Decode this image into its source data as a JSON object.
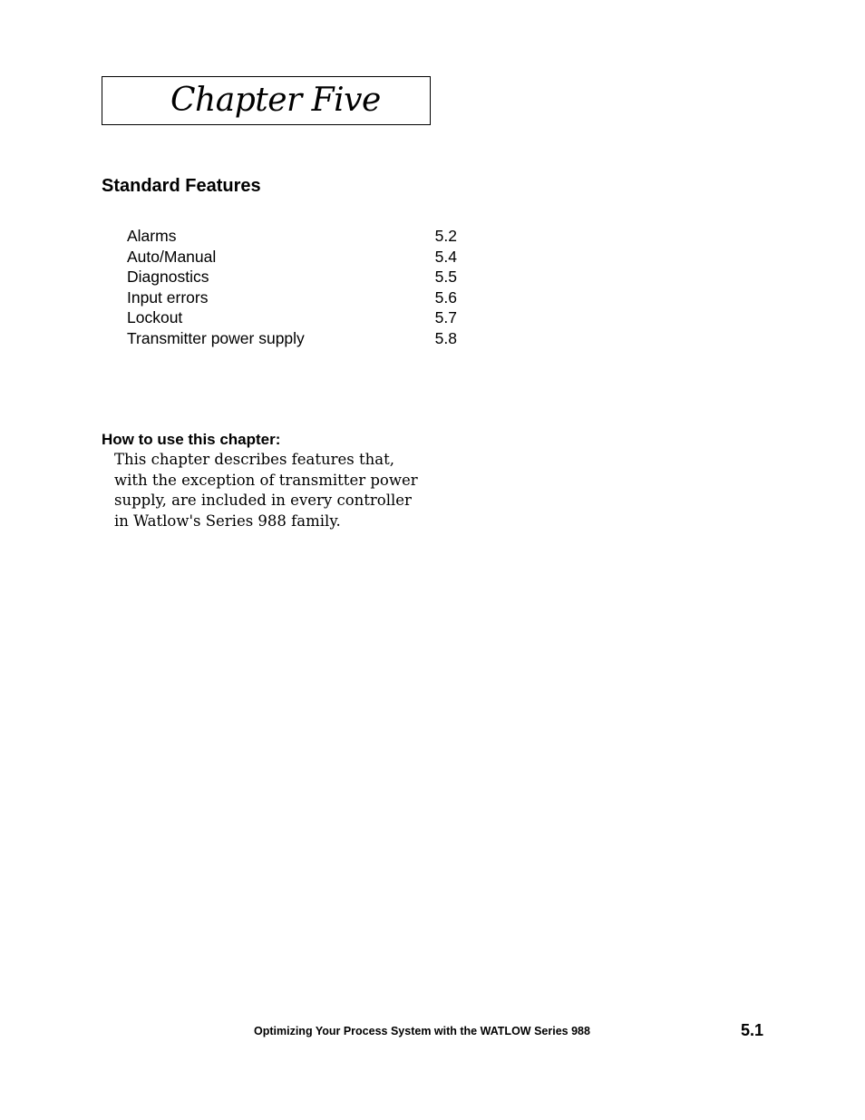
{
  "chapter": {
    "title": "Chapter Five"
  },
  "section": {
    "heading": "Standard Features"
  },
  "toc": {
    "items": [
      {
        "label": "Alarms",
        "page": "5.2"
      },
      {
        "label": "Auto/Manual",
        "page": "5.4"
      },
      {
        "label": "Diagnostics",
        "page": "5.5"
      },
      {
        "label": "Input errors",
        "page": "5.6"
      },
      {
        "label": "Lockout",
        "page": "5.7"
      },
      {
        "label": "Transmitter power supply",
        "page": "5.8"
      }
    ]
  },
  "usage": {
    "heading": "How to use this chapter:",
    "lines": [
      "This chapter describes features that,",
      "with the exception of transmitter power",
      "supply, are included in every controller",
      "in Watlow's Series 988 family."
    ]
  },
  "footer": {
    "text": "Optimizing Your Process System with the WATLOW Series 988",
    "page_number": "5.1"
  }
}
